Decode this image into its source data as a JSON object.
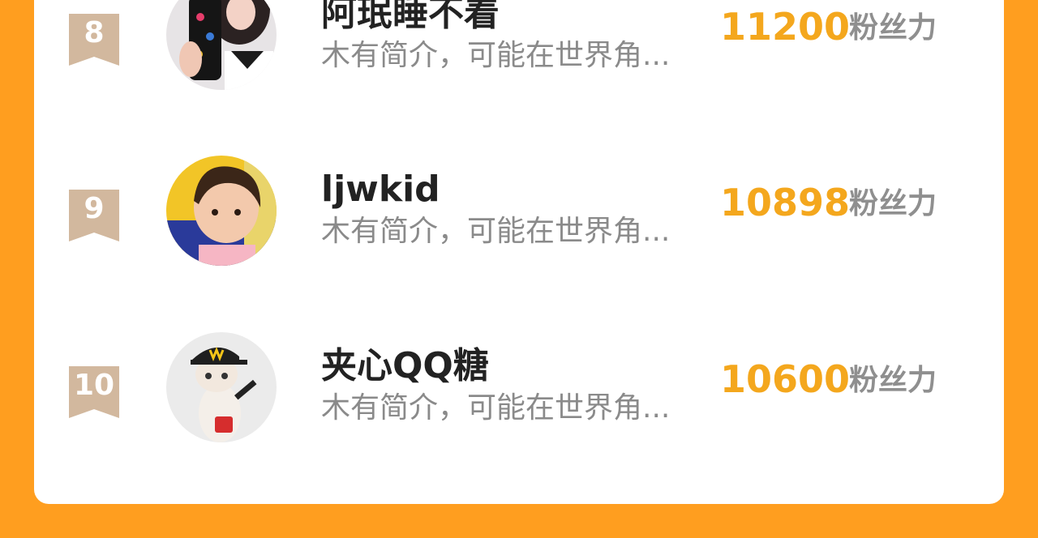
{
  "ranking": {
    "items": [
      {
        "rank": "8",
        "name": "阿珉睡不着",
        "bio": "木有简介，可能在世界角...",
        "fans_count": "11200",
        "fans_label": "粉丝力",
        "avatar": "avatar-girl-selfie"
      },
      {
        "rank": "9",
        "name": "ljwkid",
        "bio": "木有简介，可能在世界角...",
        "fans_count": "10898",
        "fans_label": "粉丝力",
        "avatar": "avatar-child-photo"
      },
      {
        "rank": "10",
        "name": "夹心QQ糖",
        "bio": "木有简介，可能在世界角...",
        "fans_count": "10600",
        "fans_label": "粉丝力",
        "avatar": "avatar-cat-mcdonalds-cap"
      }
    ]
  },
  "colors": {
    "background": "#FF9E1F",
    "card": "#FFFFFF",
    "rank_badge": "#D2B89E",
    "count": "#F4A71D",
    "name": "#222222",
    "bio": "#8A8A8A"
  }
}
